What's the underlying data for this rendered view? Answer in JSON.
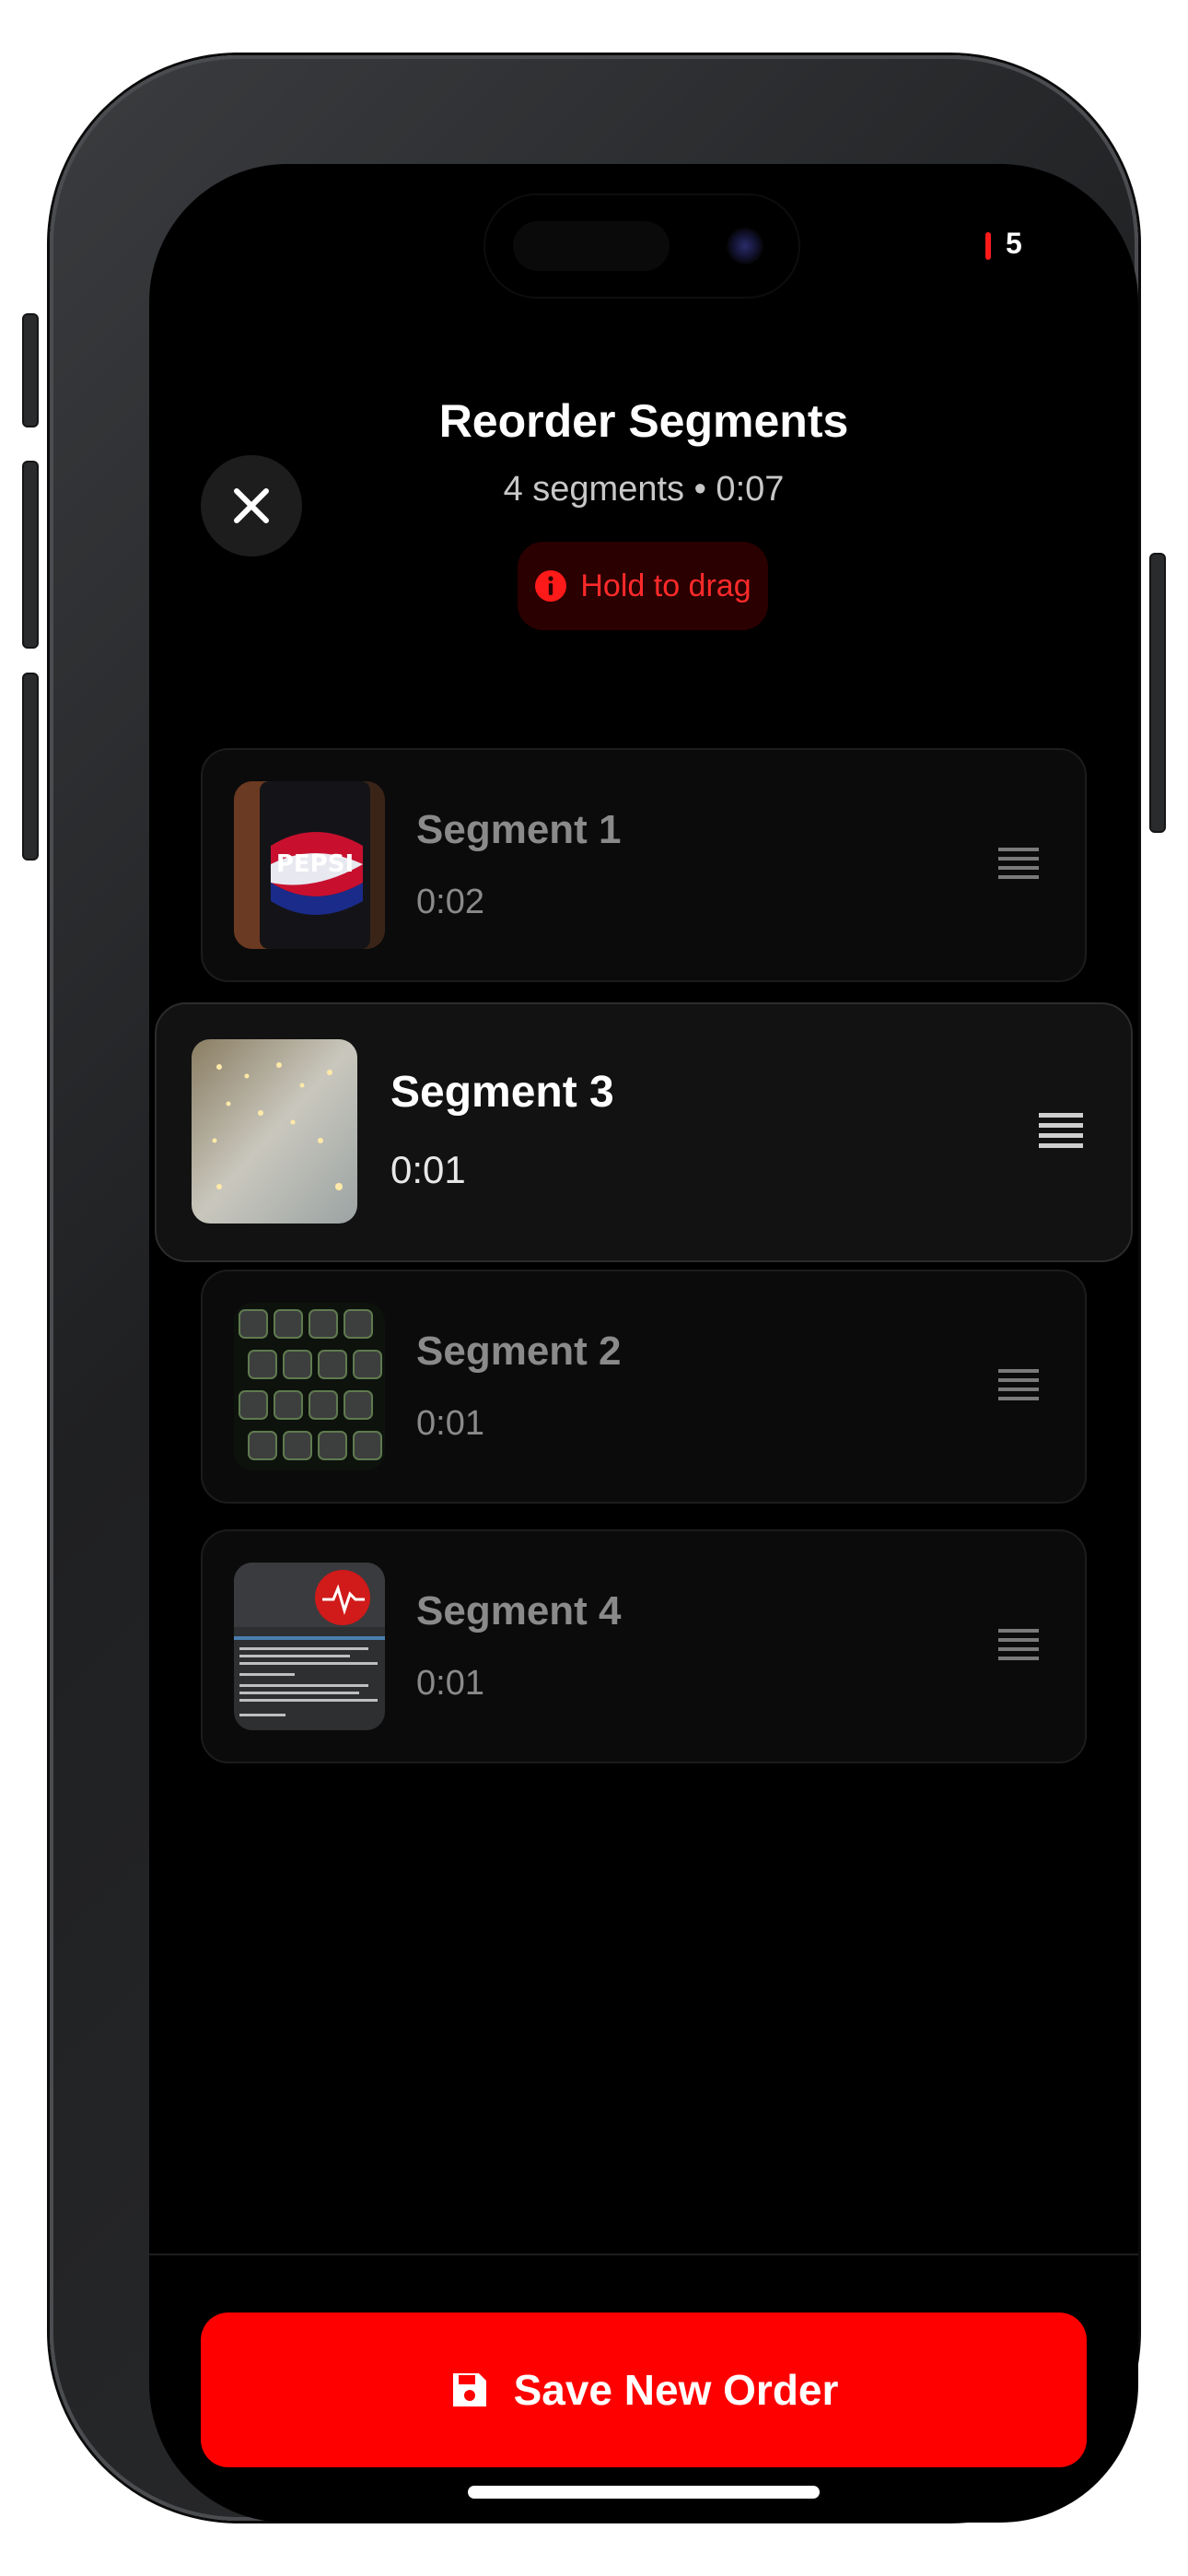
{
  "status": {
    "indicator_value": "5"
  },
  "header": {
    "title": "Reorder Segments",
    "subtitle": "4 segments • 0:07",
    "hint": "Hold to drag"
  },
  "segments": [
    {
      "name": "Segment 1",
      "duration": "0:02",
      "thumbnail": "pepsi-can-photo",
      "state": "idle"
    },
    {
      "name": "Segment 3",
      "duration": "0:01",
      "thumbnail": "string-lights-photo",
      "state": "dragging"
    },
    {
      "name": "Segment 2",
      "duration": "0:01",
      "thumbnail": "green-keyboard-photo",
      "state": "idle"
    },
    {
      "name": "Segment 4",
      "duration": "0:01",
      "thumbnail": "screen-document-photo",
      "state": "idle"
    }
  ],
  "footer": {
    "save_label": "Save New Order"
  },
  "icons": {
    "close": "close-icon",
    "info": "info-icon",
    "drag": "drag-handle-icon",
    "save": "floppy-disk-icon"
  },
  "colors": {
    "accent": "#ff0000",
    "background": "#000000",
    "card": "#0b0b0b",
    "active_card": "#121212",
    "hint_background": "#2a0000"
  }
}
